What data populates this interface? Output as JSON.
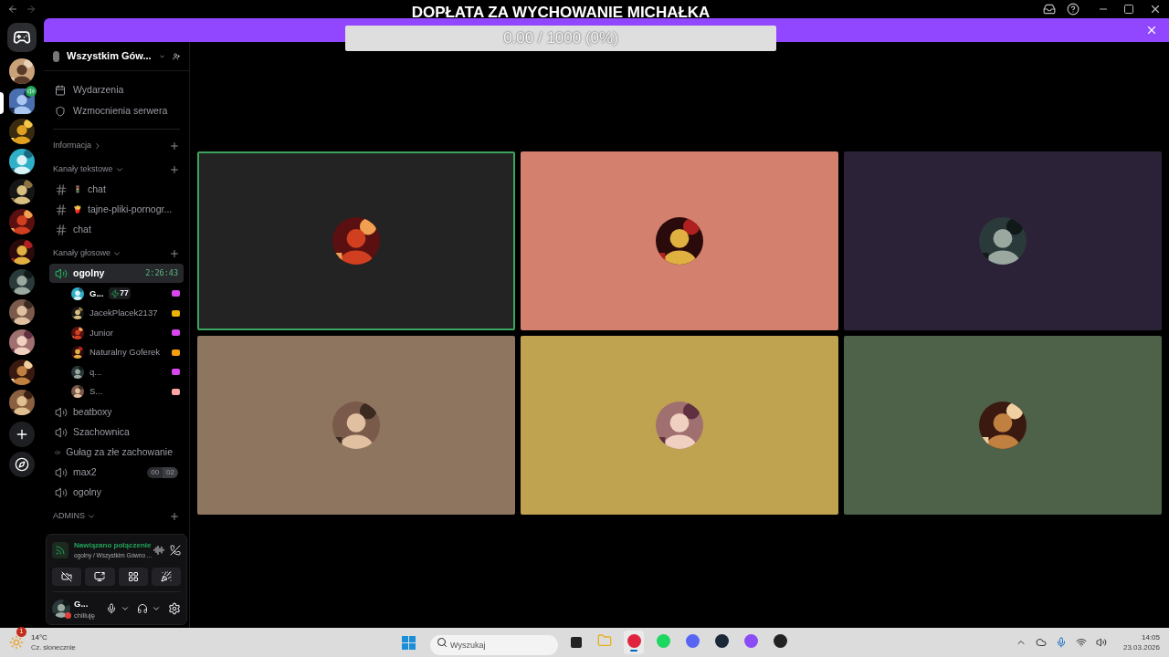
{
  "overlay": {
    "title": "DOPŁATA ZA WYCHOWANIE MICHAŁKA",
    "progress": {
      "text": "0.00 / 1000 (0%)",
      "level": 0
    }
  },
  "servers": [
    {
      "selected": false,
      "speaking": false
    },
    {
      "selected": true,
      "speaking": true
    },
    {
      "selected": false,
      "speaking": false
    },
    {
      "selected": false,
      "speaking": false
    },
    {
      "selected": false,
      "speaking": false
    },
    {
      "selected": false,
      "speaking": false
    },
    {
      "selected": false,
      "speaking": false
    },
    {
      "selected": false,
      "speaking": false
    },
    {
      "selected": false,
      "speaking": false
    },
    {
      "selected": false,
      "speaking": false
    },
    {
      "selected": false,
      "speaking": false
    },
    {
      "selected": false,
      "speaking": false
    }
  ],
  "server_name": "Wszystkim Gów...",
  "top_items": [
    {
      "kind": "events",
      "label": "Wydarzenia"
    },
    {
      "kind": "boost",
      "label": "Wzmocnienia serwera"
    }
  ],
  "sections": [
    {
      "title": "Informacja",
      "expanded": false
    },
    {
      "title": "Kanały tekstowe",
      "expanded": true,
      "channels": [
        {
          "kind": "text",
          "emoji": "🚦",
          "name": "chat",
          "selected": false
        },
        {
          "kind": "text",
          "emoji": "🍟",
          "name": "tajne-pliki-pornogr...",
          "selected": false
        },
        {
          "kind": "text",
          "name": "chat",
          "selected": false
        }
      ]
    },
    {
      "title": "Kanały głosowe",
      "expanded": true,
      "channels": [
        {
          "kind": "voice",
          "name": "ogolny",
          "selected": true,
          "timer": "2:26:43",
          "users": [
            {
              "name": "G...",
              "boost": "77",
              "color": "#d946ef"
            },
            {
              "name": "JacekPlacek2137",
              "color": "#eab308"
            },
            {
              "name": "Junior",
              "color": "#d946ef"
            },
            {
              "name": "Naturalny Goferek",
              "color": "#f59e0b"
            },
            {
              "name": "q...",
              "color": "#d946ef"
            },
            {
              "name": "S...",
              "color": "#fca5a5"
            }
          ]
        },
        {
          "kind": "voice",
          "name": "beatboxy",
          "selected": false
        },
        {
          "kind": "voice",
          "name": "Szachownica",
          "selected": false
        },
        {
          "kind": "voice",
          "name": "Gułag za złe zachowanie",
          "selected": false
        },
        {
          "kind": "voice",
          "name": "max2",
          "selected": false,
          "counter": [
            "00",
            "02"
          ]
        },
        {
          "kind": "voice",
          "name": "ogolny",
          "selected": false
        }
      ]
    },
    {
      "title": "ADMINS",
      "expanded": true
    }
  ],
  "voice_panel": {
    "status": "Nawiązano połączenie",
    "location": "ogolny / Wszystkim Gówno ..."
  },
  "user_panel": {
    "name": "G...",
    "activity": "chilluję"
  },
  "tiles": [
    {
      "color": "#232323",
      "speaking": true
    },
    {
      "color": "#d4806e",
      "speaking": false
    },
    {
      "color": "#2c2238",
      "speaking": false
    },
    {
      "color": "#8e7560",
      "speaking": false
    },
    {
      "color": "#bfa350",
      "speaking": false
    },
    {
      "color": "#4e6149",
      "speaking": false
    }
  ],
  "taskbar": {
    "weather": {
      "badge": "1",
      "temp": "14°C",
      "desc": "Cz. słonecznie"
    },
    "search": {
      "placeholder": "Wyszukaj"
    },
    "apps": [
      {
        "kind": "folder",
        "selected": false
      },
      {
        "kind": "opera",
        "selected": true
      },
      {
        "kind": "spotify",
        "selected": false
      },
      {
        "kind": "discord",
        "selected": false
      },
      {
        "kind": "steam",
        "selected": false
      },
      {
        "kind": "messenger",
        "selected": false
      },
      {
        "kind": "obs",
        "selected": false
      }
    ],
    "time": "14:05",
    "date": "23.03.2026"
  }
}
